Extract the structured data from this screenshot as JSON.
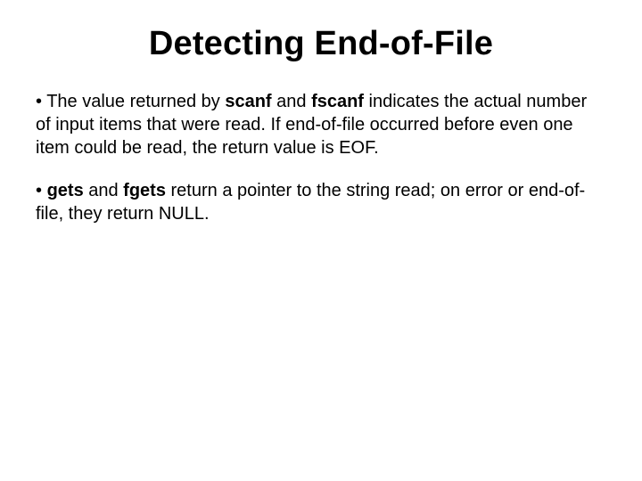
{
  "slide": {
    "title": "Detecting End-of-File",
    "bullets": [
      {
        "mark": "• ",
        "t1": "The value returned by ",
        "b1": "scanf",
        "t2": " and ",
        "b2": "fscanf",
        "t3": " indicates the actual number of input items that were read. If end-of-file occurred before even one item could be read, the return value is EOF."
      },
      {
        "mark": "• ",
        "b1": "gets",
        "t1": " and ",
        "b2": "fgets",
        "t2": " return a pointer to the string read; on error or end-of-file, they return NULL."
      }
    ]
  }
}
